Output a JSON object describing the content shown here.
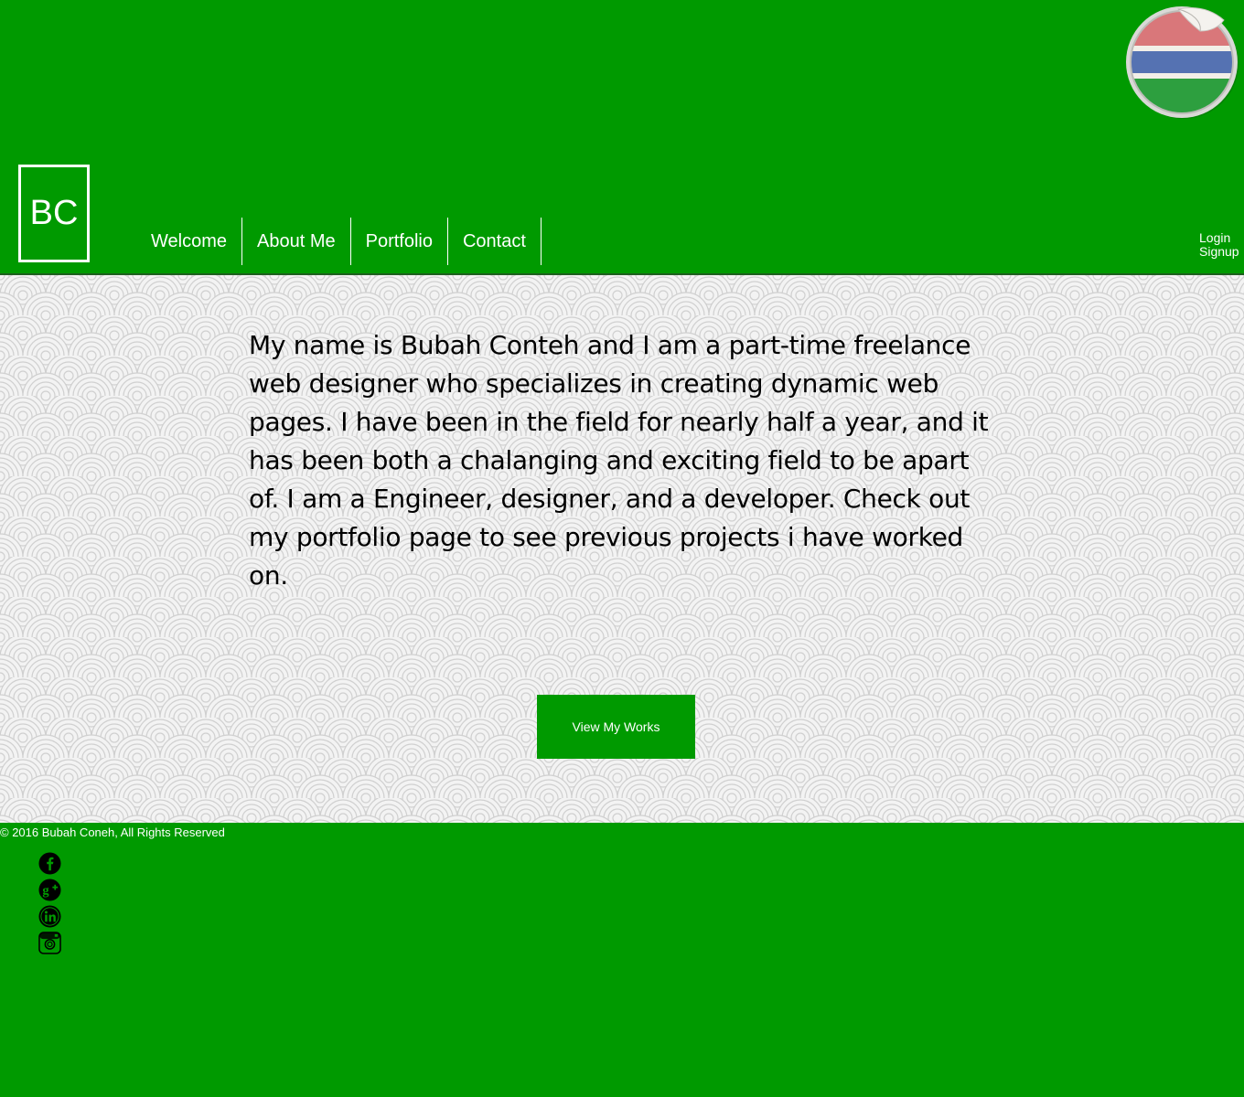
{
  "colors": {
    "brand_green": "#009a00",
    "text_dark": "#000000",
    "text_light": "#ffffff",
    "pattern_bg": "#f3f3f3"
  },
  "header": {
    "logo_text": "BC",
    "nav": [
      {
        "label": "Welcome"
      },
      {
        "label": "About Me"
      },
      {
        "label": "Portfolio"
      },
      {
        "label": "Contact"
      }
    ],
    "login_label": "Login",
    "signup_label": "Signup",
    "flag_icon": "gambia-flag-sticker-icon"
  },
  "main": {
    "bio": "My name is Bubah Conteh and I am a part-time freelance web designer who specializes in creating dynamic web pages. I have been in the field for nearly half a year, and it has been both a chalanging and exciting field to be apart of. I am a Engineer, designer, and a developer. Check out my portfolio page to see previous projects i have worked on.",
    "cta_label": "View My Works"
  },
  "footer": {
    "copyright": "© 2016 Bubah Coneh, All Rights Reserved",
    "social_icons": [
      "facebook-icon",
      "google-plus-icon",
      "linkedin-icon",
      "instagram-icon"
    ]
  }
}
